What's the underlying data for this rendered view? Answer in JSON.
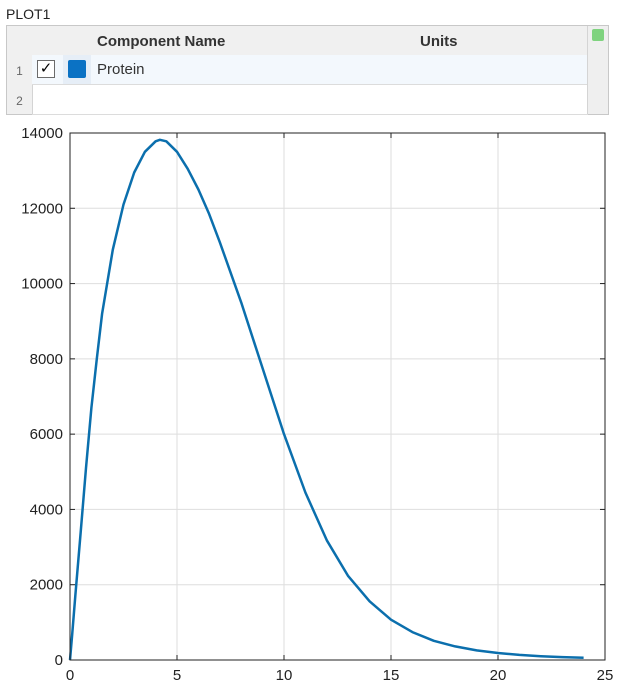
{
  "plot": {
    "title": "PLOT1"
  },
  "table": {
    "headers": {
      "name": "Component Name",
      "units": "Units"
    },
    "rows": [
      {
        "number": "1",
        "checked": true,
        "check_glyph": "✓",
        "color": "#0b72c4",
        "name": "Protein",
        "units": ""
      },
      {
        "number": "2",
        "checked": false,
        "name": "",
        "units": ""
      }
    ],
    "status_color": "#7fd37f"
  },
  "chart_data": {
    "type": "line",
    "x_ticks": [
      0,
      5,
      10,
      15,
      20,
      25
    ],
    "y_ticks": [
      0,
      2000,
      4000,
      6000,
      8000,
      10000,
      12000,
      14000
    ],
    "xlim": [
      0,
      25
    ],
    "ylim": [
      0,
      14000
    ],
    "grid": true,
    "series": [
      {
        "color": "#0b6fad",
        "x": [
          0,
          0.1,
          0.25,
          0.5,
          0.75,
          1,
          1.25,
          1.5,
          2,
          2.5,
          3,
          3.5,
          4,
          4.2,
          4.5,
          5,
          5.5,
          6,
          6.5,
          7,
          8,
          9,
          10,
          11,
          12,
          13,
          14,
          15,
          16,
          17,
          18,
          19,
          20,
          21,
          22,
          23,
          24
        ],
        "y": [
          0,
          650,
          1700,
          3400,
          5100,
          6700,
          8000,
          9200,
          10900,
          12100,
          12950,
          13500,
          13780,
          13820,
          13780,
          13500,
          13050,
          12500,
          11850,
          11100,
          9500,
          7750,
          6000,
          4450,
          3180,
          2230,
          1560,
          1070,
          740,
          510,
          360,
          255,
          185,
          135,
          100,
          78,
          60
        ]
      }
    ]
  }
}
